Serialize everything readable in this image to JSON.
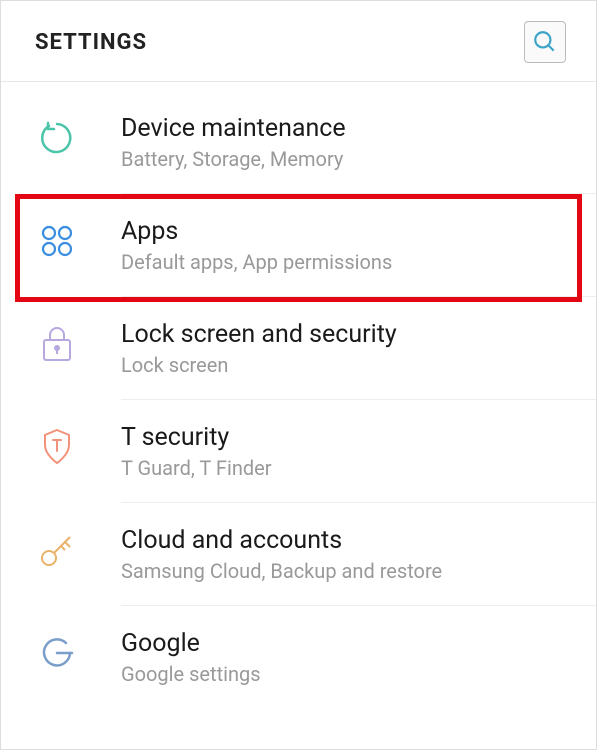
{
  "header": {
    "title": "SETTINGS"
  },
  "items": [
    {
      "title": "Device maintenance",
      "subtitle": "Battery, Storage, Memory"
    },
    {
      "title": "Apps",
      "subtitle": "Default apps, App permissions"
    },
    {
      "title": "Lock screen and security",
      "subtitle": "Lock screen"
    },
    {
      "title": "T security",
      "subtitle": "T Guard, T Finder"
    },
    {
      "title": "Cloud and accounts",
      "subtitle": "Samsung Cloud, Backup and restore"
    },
    {
      "title": "Google",
      "subtitle": "Google settings"
    }
  ]
}
